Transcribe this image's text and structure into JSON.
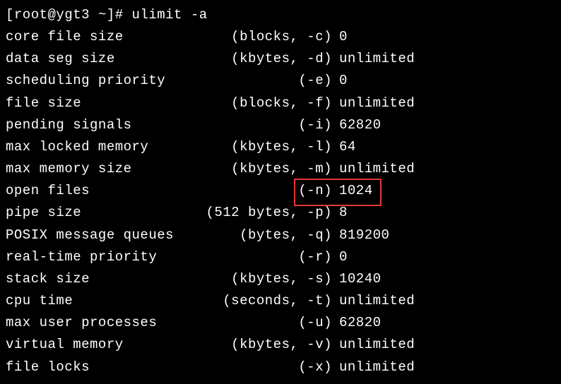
{
  "prompt": {
    "user_host": "[root@ygt3 ~]#",
    "command": "ulimit -a"
  },
  "rows": [
    {
      "label": "core file size",
      "unit": "(blocks, -c)",
      "value": "0"
    },
    {
      "label": "data seg size",
      "unit": "(kbytes, -d)",
      "value": "unlimited"
    },
    {
      "label": "scheduling priority",
      "unit": "(-e)",
      "value": "0"
    },
    {
      "label": "file size",
      "unit": "(blocks, -f)",
      "value": "unlimited"
    },
    {
      "label": "pending signals",
      "unit": "(-i)",
      "value": "62820"
    },
    {
      "label": "max locked memory",
      "unit": "(kbytes, -l)",
      "value": "64"
    },
    {
      "label": "max memory size",
      "unit": "(kbytes, -m)",
      "value": "unlimited"
    },
    {
      "label": "open files",
      "unit": "(-n)",
      "value": "1024"
    },
    {
      "label": "pipe size",
      "unit": "(512 bytes, -p)",
      "value": "8"
    },
    {
      "label": "POSIX message queues",
      "unit": "(bytes, -q)",
      "value": "819200"
    },
    {
      "label": "real-time priority",
      "unit": "(-r)",
      "value": "0"
    },
    {
      "label": "stack size",
      "unit": "(kbytes, -s)",
      "value": "10240"
    },
    {
      "label": "cpu time",
      "unit": "(seconds, -t)",
      "value": "unlimited"
    },
    {
      "label": "max user processes",
      "unit": "(-u)",
      "value": "62820"
    },
    {
      "label": "virtual memory",
      "unit": "(kbytes, -v)",
      "value": "unlimited"
    },
    {
      "label": "file locks",
      "unit": "(-x)",
      "value": "unlimited"
    }
  ],
  "highlight": {
    "row_index": 7,
    "color": "#e53935"
  }
}
